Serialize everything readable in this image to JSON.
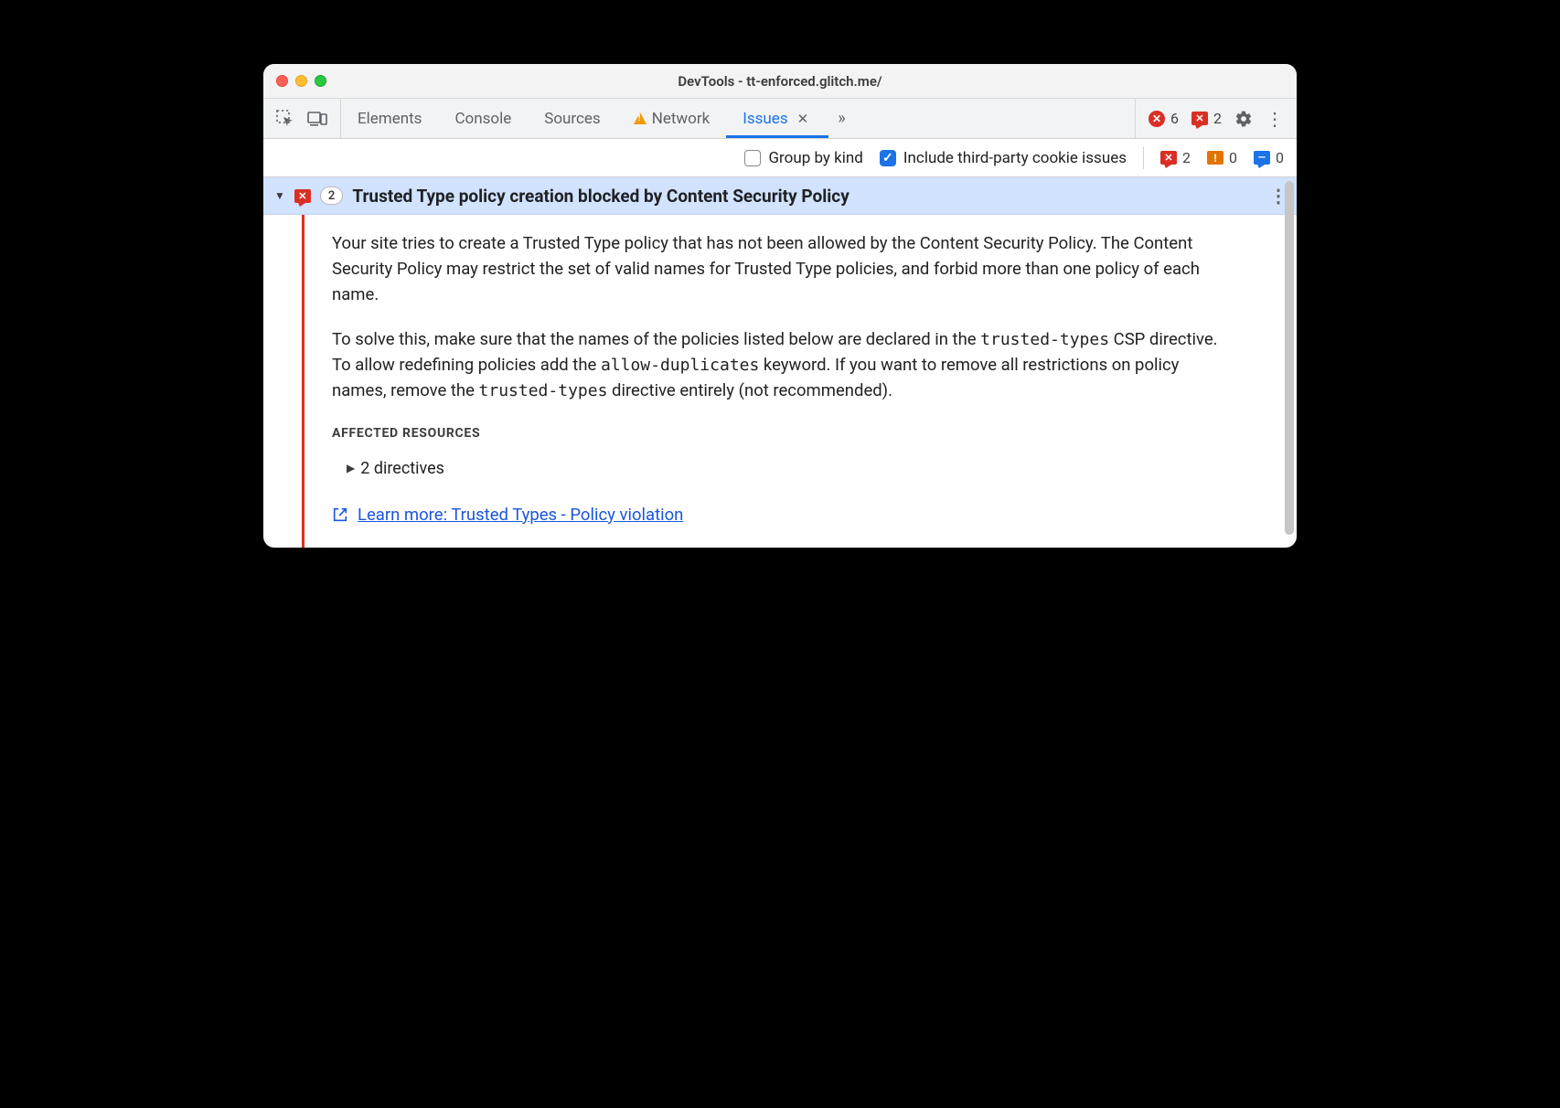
{
  "window_title": "DevTools - tt-enforced.glitch.me/",
  "tabs": {
    "elements": "Elements",
    "console": "Console",
    "sources": "Sources",
    "network": "Network",
    "issues": "Issues"
  },
  "top_counts": {
    "errors": "6",
    "page_errors": "2"
  },
  "filters": {
    "group_by_kind": "Group by kind",
    "third_party": "Include third-party cookie issues",
    "err_count": "2",
    "warn_count": "0",
    "info_count": "0"
  },
  "issue": {
    "count": "2",
    "title": "Trusted Type policy creation blocked by Content Security Policy",
    "p1": "Your site tries to create a Trusted Type policy that has not been allowed by the Content Security Policy. The Content Security Policy may restrict the set of valid names for Trusted Type policies, and forbid more than one policy of each name.",
    "p2_a": "To solve this, make sure that the names of the policies listed below are declared in the ",
    "p2_code1": "trusted-types",
    "p2_b": " CSP directive. To allow redefining policies add the ",
    "p2_code2": "allow-duplicates",
    "p2_c": " keyword. If you want to remove all restrictions on policy names, remove the ",
    "p2_code3": "trusted-types",
    "p2_d": " directive entirely (not recommended).",
    "affected_header": "AFFECTED RESOURCES",
    "directives": "2 directives",
    "learn_more": "Learn more: Trusted Types - Policy violation"
  }
}
